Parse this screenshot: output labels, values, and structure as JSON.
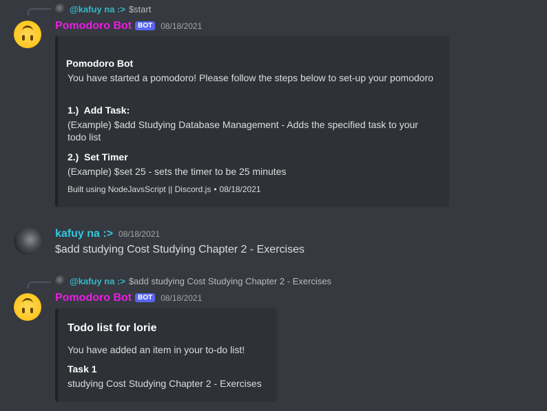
{
  "messages": [
    {
      "reply": {
        "author": "@kafuy na :>",
        "text": "$start"
      },
      "author": "Pomodoro Bot",
      "bot_tag": "BOT",
      "timestamp": "08/18/2021",
      "embed": {
        "author": "Pomodoro Bot",
        "description": "You have started a pomodoro! Please follow the steps below to set-up your pomodoro",
        "fields": [
          {
            "name": "1.)  Add Task:",
            "value": "(Example) $add Studying Database Management - Adds the specified task to your todo list"
          },
          {
            "name": "2.)  Set Timer",
            "value": "(Example) $set 25 - sets the timer to be 25 minutes"
          }
        ],
        "footer_text": "Built using NodeJavsScript || Discord.js",
        "footer_separator": "•",
        "footer_timestamp": "08/18/2021"
      }
    },
    {
      "author": "kafuy na :>",
      "timestamp": "08/18/2021",
      "text": "$add studying Cost Studying Chapter 2 - Exercises"
    },
    {
      "reply": {
        "author": "@kafuy na :>",
        "text": "$add studying Cost Studying Chapter 2 - Exercises"
      },
      "author": "Pomodoro Bot",
      "bot_tag": "BOT",
      "timestamp": "08/18/2021",
      "embed": {
        "title": "Todo list for lorie",
        "description": "You have added an item in your to-do list!",
        "fields": [
          {
            "name": "Task 1",
            "value": "studying Cost Studying Chapter 2 - Exercises"
          }
        ]
      }
    }
  ],
  "colors": {
    "background": "#36393f",
    "embed_background": "#2f3136",
    "bot_name": "#e91ee4",
    "user_name": "#33c8e0",
    "bot_tag": "#5865f2"
  },
  "icons": {
    "bot_avatar": "upside-down-face-emoji",
    "user_avatar": "user-photo"
  }
}
